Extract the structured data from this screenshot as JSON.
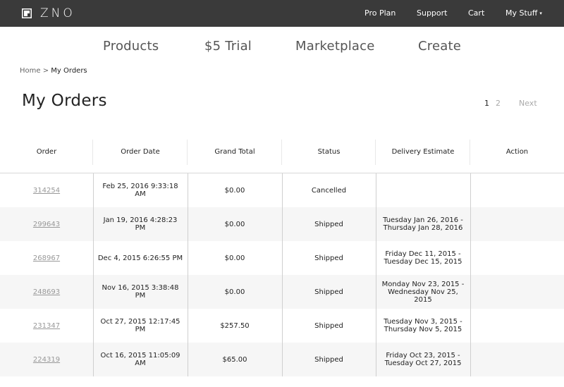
{
  "header": {
    "logo_text": "ZNO",
    "nav": [
      {
        "label": "Pro Plan"
      },
      {
        "label": "Support"
      },
      {
        "label": "Cart"
      },
      {
        "label": "My Stuff"
      }
    ],
    "my_stuff_caret": "▾"
  },
  "main_nav": [
    {
      "label": "Products"
    },
    {
      "label": "$5 Trial"
    },
    {
      "label": "Marketplace"
    },
    {
      "label": "Create"
    }
  ],
  "breadcrumb": {
    "home": "Home",
    "separator": " > ",
    "current": "My Orders"
  },
  "page_title": "My Orders",
  "pagination": {
    "pages": [
      "1",
      "2"
    ],
    "current": "1",
    "next_label": "Next"
  },
  "table": {
    "columns": [
      "Order",
      "Order Date",
      "Grand Total",
      "Status",
      "Delivery Estimate",
      "Action"
    ],
    "rows": [
      {
        "order": "314254",
        "date": "Feb 25, 2016 9:33:18 AM",
        "total": "$0.00",
        "status": "Cancelled",
        "delivery": "",
        "action": ""
      },
      {
        "order": "299643",
        "date": "Jan 19, 2016 4:28:23 PM",
        "total": "$0.00",
        "status": "Shipped",
        "delivery": "Tuesday Jan 26, 2016 - Thursday Jan 28, 2016",
        "action": ""
      },
      {
        "order": "268967",
        "date": "Dec 4, 2015 6:26:55 PM",
        "total": "$0.00",
        "status": "Shipped",
        "delivery": "Friday Dec 11, 2015 - Tuesday Dec 15, 2015",
        "action": ""
      },
      {
        "order": "248693",
        "date": "Nov 16, 2015 3:38:48 PM",
        "total": "$0.00",
        "status": "Shipped",
        "delivery": "Monday Nov 23, 2015 - Wednesday Nov 25, 2015",
        "action": ""
      },
      {
        "order": "231347",
        "date": "Oct 27, 2015 12:17:45 PM",
        "total": "$257.50",
        "status": "Shipped",
        "delivery": "Tuesday Nov 3, 2015 - Thursday Nov 5, 2015",
        "action": ""
      },
      {
        "order": "224319",
        "date": "Oct 16, 2015 11:05:09 AM",
        "total": "$65.00",
        "status": "Shipped",
        "delivery": "Friday Oct 23, 2015 - Tuesday Oct 27, 2015",
        "action": ""
      }
    ]
  },
  "colors": {
    "topbar": "#3a3a3a",
    "row_alt": "#f6f6f6",
    "link_muted": "#999999"
  }
}
